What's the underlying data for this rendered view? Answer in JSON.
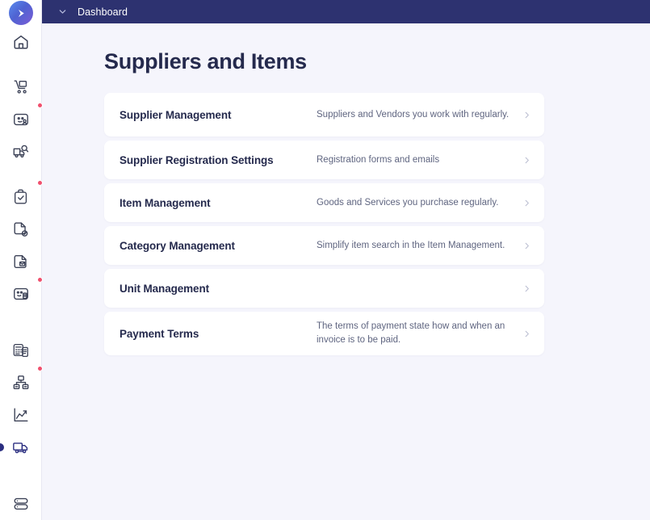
{
  "brand": {
    "logo_icon": "play-circle-logo",
    "gradient_from": "#5b8def",
    "gradient_to": "#7b5cd6"
  },
  "topbar": {
    "chevron_icon": "chevron-down-icon",
    "title": "Dashboard",
    "background": "#2d3270",
    "text_color": "#ffffff"
  },
  "page": {
    "title": "Suppliers and Items",
    "background": "#f5f5fc"
  },
  "sidebar": {
    "background": "#ffffff",
    "active_color": "#2b2e80",
    "badge_color": "#f0506e",
    "items": [
      {
        "name": "home",
        "icon": "home-icon",
        "badge": false,
        "active": false
      },
      {
        "name": "purchase-requisition",
        "icon": "hand-truck-icon",
        "badge": false,
        "active": false
      },
      {
        "name": "suppliers",
        "icon": "supplier-card-icon",
        "badge": true,
        "active": false
      },
      {
        "name": "sourcing",
        "icon": "truck-search-icon",
        "badge": false,
        "active": false
      },
      {
        "name": "approvals",
        "icon": "clipboard-check-icon",
        "badge": true,
        "active": false
      },
      {
        "name": "contracts",
        "icon": "document-check-icon",
        "badge": false,
        "active": false
      },
      {
        "name": "orders",
        "icon": "document-box-icon",
        "badge": false,
        "active": false
      },
      {
        "name": "invoices-cards",
        "icon": "invoice-card-icon",
        "badge": true,
        "active": false
      },
      {
        "name": "accounting",
        "icon": "calculator-invoice-icon",
        "badge": false,
        "active": false
      },
      {
        "name": "organization",
        "icon": "sitemap-icon",
        "badge": true,
        "active": false
      },
      {
        "name": "analytics",
        "icon": "line-chart-icon",
        "badge": false,
        "active": false
      },
      {
        "name": "logistics",
        "icon": "delivery-truck-icon",
        "badge": false,
        "active": true
      },
      {
        "name": "master-data",
        "icon": "server-stack-icon",
        "badge": false,
        "active": false
      }
    ]
  },
  "main": {
    "chevron_icon": "chevron-right-icon",
    "cards": [
      {
        "title": "Supplier Management",
        "description": "Suppliers and Vendors you work with regularly.",
        "tall": true
      },
      {
        "title": "Supplier Registration Settings",
        "description": "Registration forms and emails",
        "tall": false
      },
      {
        "title": "Item Management",
        "description": "Goods and Services you purchase regularly.",
        "tall": false
      },
      {
        "title": "Category Management",
        "description": "Simplify item search in the Item Management.",
        "tall": false
      },
      {
        "title": "Unit Management",
        "description": "",
        "tall": false
      },
      {
        "title": "Payment Terms",
        "description": "The terms of payment state how and when an invoice is to be paid.",
        "tall": true
      }
    ]
  }
}
